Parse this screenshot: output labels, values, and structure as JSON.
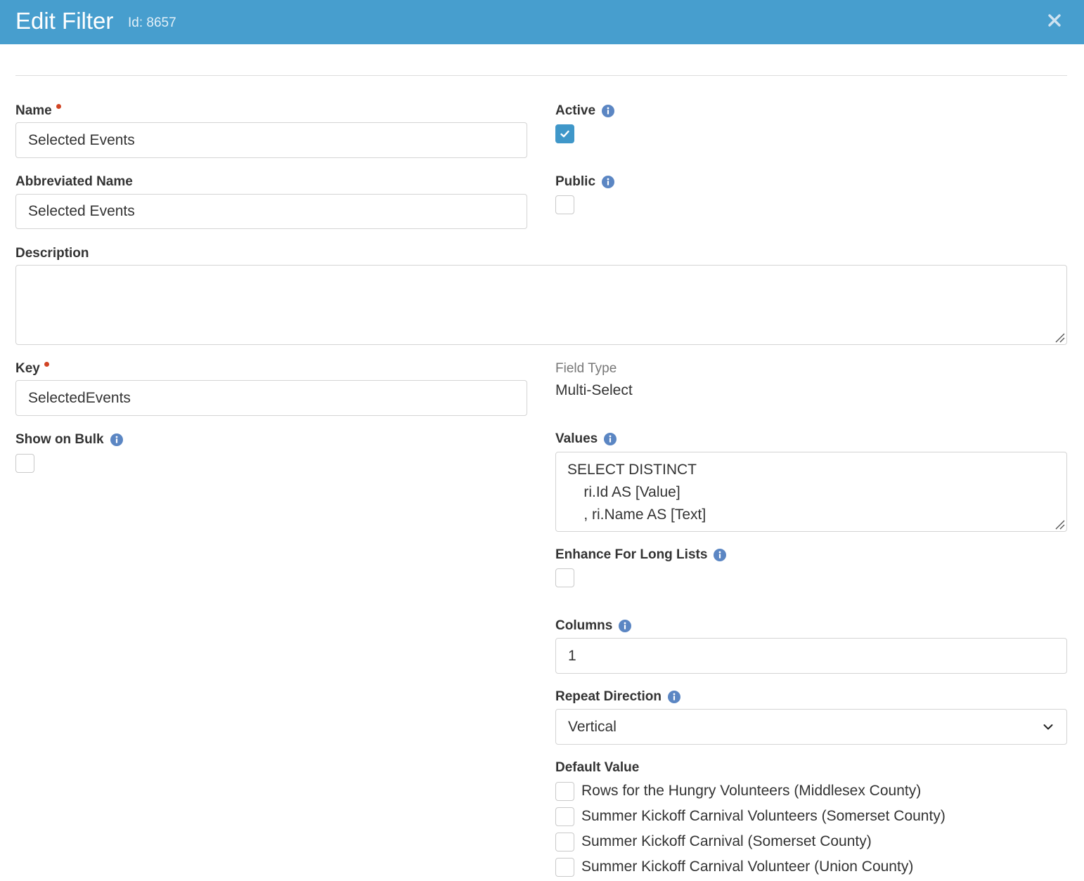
{
  "header": {
    "title": "Edit Filter",
    "id_text": "Id: 8657",
    "close_icon": "close-icon"
  },
  "colors": {
    "header_bg": "#479ece",
    "required_dot": "#d14424",
    "info_icon": "#5b86c3",
    "checkbox_checked": "#3f97c9"
  },
  "form": {
    "name": {
      "label": "Name",
      "value": "Selected Events",
      "required": true
    },
    "active": {
      "label": "Active",
      "checked": true,
      "icon": "info-icon"
    },
    "abbreviated_name": {
      "label": "Abbreviated Name",
      "value": "Selected Events"
    },
    "public": {
      "label": "Public",
      "checked": false,
      "icon": "info-icon"
    },
    "description": {
      "label": "Description",
      "value": ""
    },
    "key": {
      "label": "Key",
      "value": "SelectedEvents",
      "required": true
    },
    "field_type": {
      "label": "Field Type",
      "value": "Multi-Select"
    },
    "show_on_bulk": {
      "label": "Show on Bulk",
      "checked": false,
      "icon": "info-icon"
    },
    "values": {
      "label": "Values",
      "icon": "info-icon",
      "lines": [
        "SELECT DISTINCT",
        "    ri.Id AS [Value]",
        "    , ri.Name AS [Text]"
      ]
    },
    "enhance_for_long_lists": {
      "label": "Enhance For Long Lists",
      "checked": false,
      "icon": "info-icon"
    },
    "columns": {
      "label": "Columns",
      "value": "1",
      "icon": "info-icon"
    },
    "repeat_direction": {
      "label": "Repeat Direction",
      "value": "Vertical",
      "icon": "info-icon"
    },
    "default_value": {
      "label": "Default Value",
      "options": [
        {
          "label": "Rows for the Hungry Volunteers (Middlesex County)",
          "checked": false
        },
        {
          "label": "Summer Kickoff Carnival Volunteers (Somerset County)",
          "checked": false
        },
        {
          "label": "Summer Kickoff Carnival (Somerset County)",
          "checked": false
        },
        {
          "label": "Summer Kickoff Carnival Volunteer (Union County)",
          "checked": false
        }
      ]
    }
  }
}
